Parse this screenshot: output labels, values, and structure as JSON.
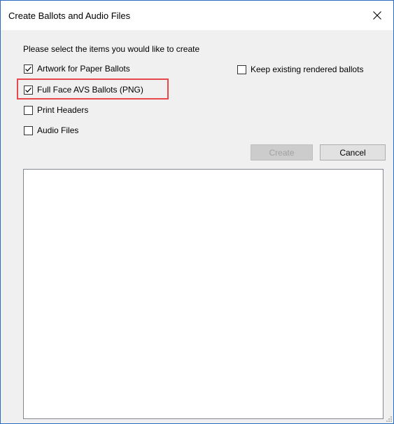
{
  "window": {
    "title": "Create Ballots and Audio Files"
  },
  "instructions": "Please select the items you would like to create",
  "options": [
    {
      "label": "Artwork for Paper Ballots",
      "checked": true
    },
    {
      "label": "Full Face AVS Ballots (PNG)",
      "checked": true,
      "highlighted": true
    },
    {
      "label": "Print Headers",
      "checked": false
    },
    {
      "label": "Audio Files",
      "checked": false
    }
  ],
  "keep_option": {
    "label": "Keep existing rendered ballots",
    "checked": false
  },
  "buttons": {
    "create_label": "Create",
    "create_enabled": false,
    "cancel_label": "Cancel"
  },
  "output_text": "",
  "colors": {
    "highlight": "#e8474b",
    "window_border": "#2b6cc4",
    "dialog_bg": "#f0f0f0"
  },
  "icons": {
    "close": "close-icon",
    "checkmark": "checkmark-icon",
    "resize_grip": "resize-grip-icon"
  }
}
